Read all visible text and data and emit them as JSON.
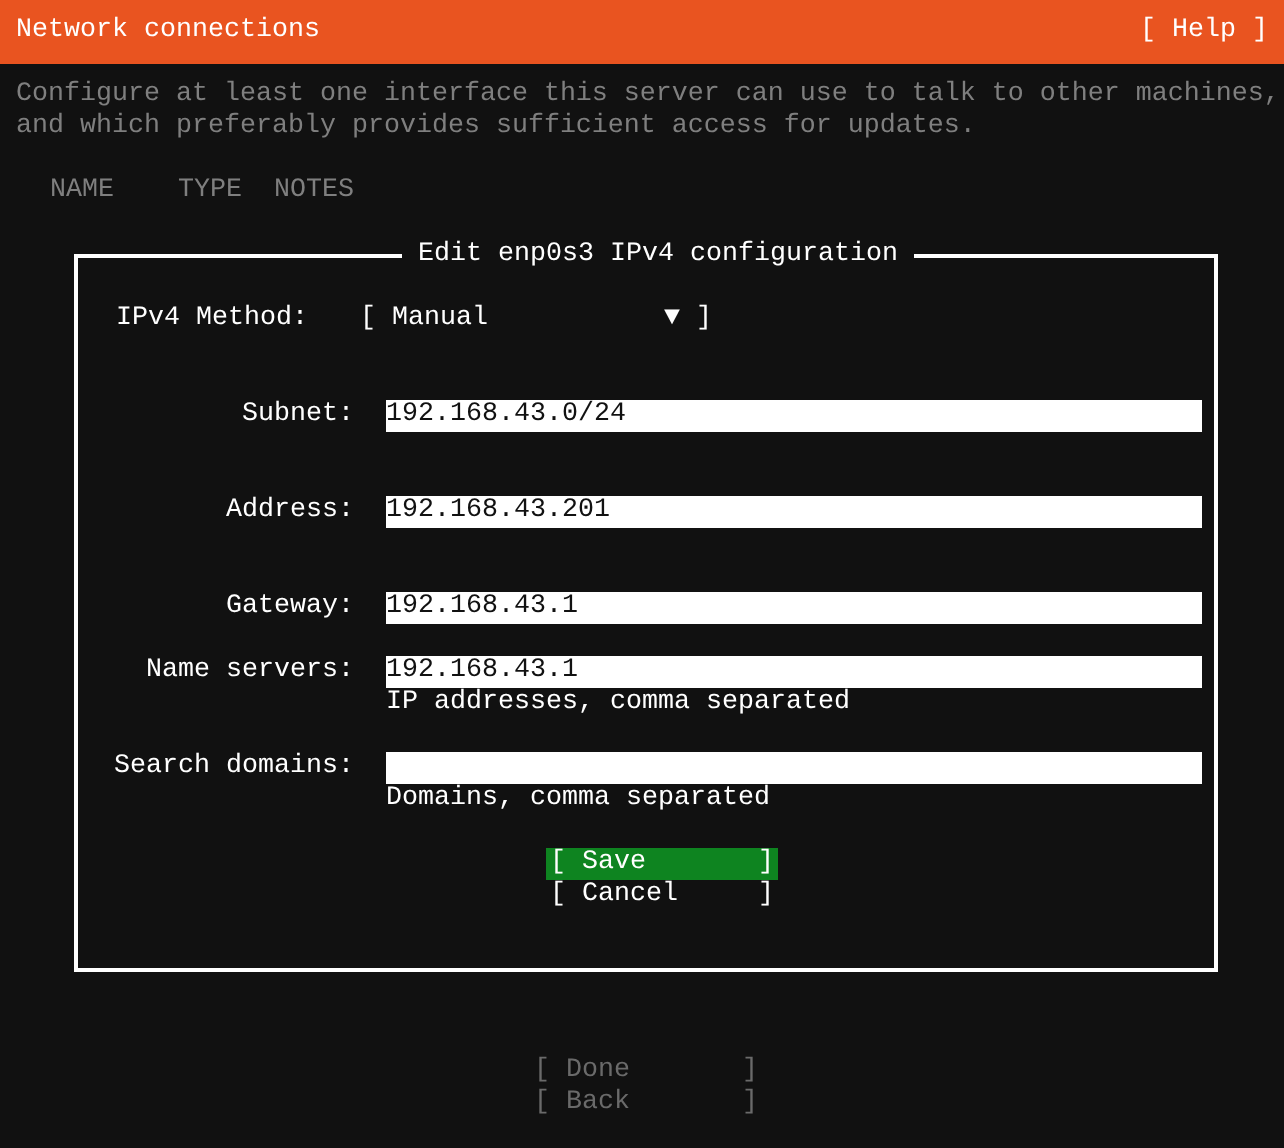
{
  "header": {
    "title": "Network connections",
    "help": "[ Help ]"
  },
  "description": "Configure at least one interface this server can use to talk to other machines, and which preferably provides sufficient access for updates.",
  "columns": [
    "NAME",
    "TYPE",
    "NOTES"
  ],
  "dialog": {
    "title": "Edit enp0s3 IPv4 configuration",
    "method": {
      "label": "IPv4 Method:",
      "value": "[ Manual           ▼ ]"
    },
    "fields": [
      {
        "label": "Subnet:",
        "value": "192.168.43.0/24"
      },
      {
        "label": "Address:",
        "value": "192.168.43.201"
      },
      {
        "label": "Gateway:",
        "value": "192.168.43.1"
      },
      {
        "label": "Name servers:",
        "value": "192.168.43.1",
        "hint": "IP addresses, comma separated"
      },
      {
        "label": "Search domains:",
        "hint": "Domains, comma separated"
      }
    ],
    "buttons": [
      {
        "label": "[ Save       ]",
        "selected": true
      },
      {
        "label": "[ Cancel     ]",
        "selected": false
      }
    ]
  },
  "footer_buttons": [
    {
      "label": "[ Done       ]",
      "disabled": true
    },
    {
      "label": "[ Back       ]",
      "disabled": true
    }
  ]
}
